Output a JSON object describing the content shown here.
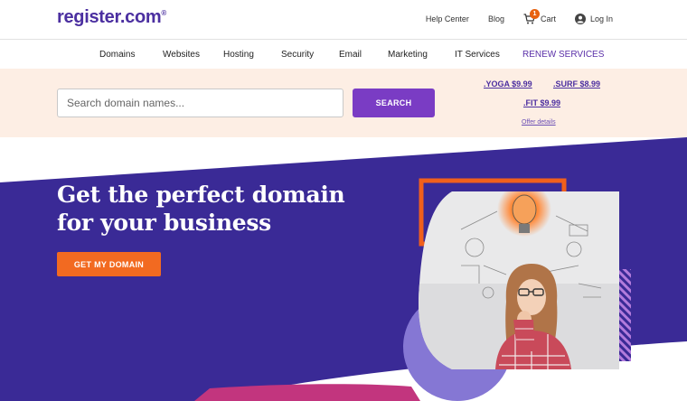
{
  "header": {
    "logo_text": "register.com",
    "logo_mark": "®",
    "links": {
      "help": "Help Center",
      "blog": "Blog",
      "cart": "Cart",
      "cart_count": "1",
      "login": "Log In"
    }
  },
  "nav": {
    "items": [
      "Domains",
      "Websites",
      "Hosting",
      "Security",
      "Email",
      "Marketing",
      "IT Services",
      "RENEW SERVICES"
    ]
  },
  "search": {
    "placeholder": "Search domain names...",
    "value": "",
    "button_label": "SEARCH"
  },
  "promos": {
    "items": [
      ".YOGA $9.99",
      ".SURF $8.99",
      ".FIT $9.99"
    ],
    "offer_details": "Offer details"
  },
  "hero": {
    "headline_line1": "Get the perfect domain",
    "headline_line2": "for your business",
    "cta_label": "GET MY DOMAIN"
  },
  "colors": {
    "brand_purple": "#3d2b96",
    "accent_orange": "#f26a21",
    "search_button": "#7a3cc4",
    "search_band": "#fdeee4"
  }
}
